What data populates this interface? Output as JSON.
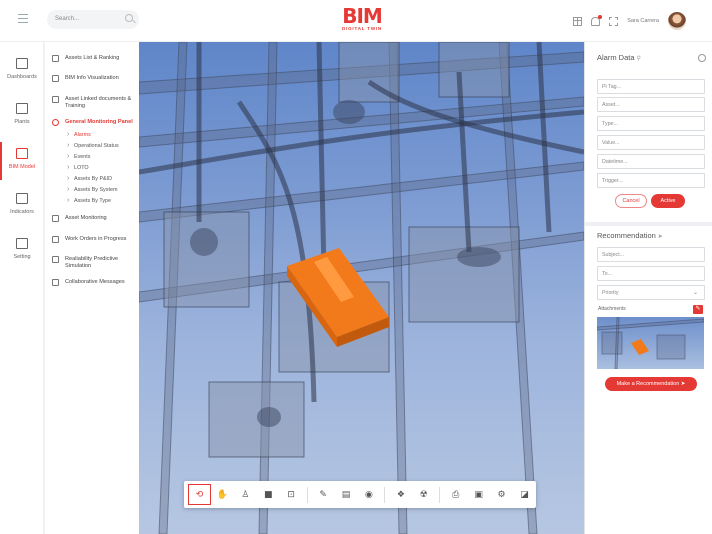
{
  "header": {
    "search_placeholder": "Search...",
    "logo_mark": "BIM",
    "logo_sub": "DIGITAL TWIN",
    "user_name": "Sara Carrera"
  },
  "leftnav": {
    "items": [
      {
        "label": "Dashboards",
        "icon": "dashboard-icon"
      },
      {
        "label": "Plants",
        "icon": "plants-icon"
      },
      {
        "label": "BIM Model",
        "icon": "cube-icon"
      },
      {
        "label": "Indicators",
        "icon": "chart-icon"
      },
      {
        "label": "Setting",
        "icon": "settings-icon"
      }
    ],
    "active_index": 2
  },
  "submenu": {
    "items": [
      {
        "label": "Assets List & Ranking"
      },
      {
        "label": "BIM Info Visualization"
      },
      {
        "label": "Asset Linked documents & Training"
      },
      {
        "label": "General Monitoring Panel"
      },
      {
        "label": "Asset Monitoring"
      },
      {
        "label": "Work Orders in Progress"
      },
      {
        "label": "Realiability Predictive Simulation"
      },
      {
        "label": "Collaborative Messages"
      }
    ],
    "subitems": [
      {
        "label": "Alarms"
      },
      {
        "label": "Operational Status"
      },
      {
        "label": "Events"
      },
      {
        "label": "LOTO"
      },
      {
        "label": "Assets By P&ID"
      },
      {
        "label": "Assets By System"
      },
      {
        "label": "Assets By Type"
      }
    ],
    "active_item_index": 3,
    "active_subitem_index": 0
  },
  "toolbar": {
    "buttons": [
      "orbit-icon",
      "pan-icon",
      "walk-icon",
      "camera-icon",
      "fit-icon",
      "measure-icon",
      "section-icon",
      "visibility-icon",
      "explode-icon",
      "model-browser-icon",
      "print-icon",
      "properties-icon",
      "settings-icon",
      "fullscreen-icon"
    ],
    "active_index": 0
  },
  "alarm_panel": {
    "title": "Alarm Data",
    "fields": [
      "Pi Tag...",
      "Asset...",
      "Type...",
      "Value...",
      "Datetime...",
      "Trigger..."
    ],
    "cancel_label": "Cancel",
    "active_label": "Active"
  },
  "recommendation_panel": {
    "title": "Recommendation",
    "subject_placeholder": "Subject...",
    "to_placeholder": "To...",
    "priority_label": "Priority",
    "attachments_label": "Attachments",
    "submit_label": "Make a Recommendation"
  },
  "colors": {
    "accent": "#e53935",
    "highlight_asset": "#f27a1a",
    "viewport_sky": "#6f91cc"
  }
}
